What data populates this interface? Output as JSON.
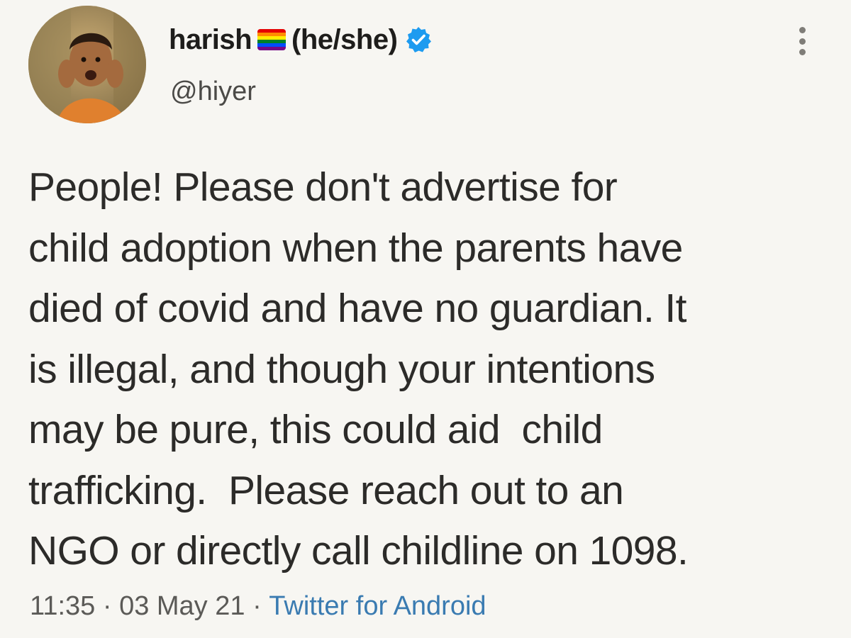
{
  "author": {
    "name": "harish",
    "pronouns": "(he/she)",
    "handle": "@hiyer",
    "flag_icon": "rainbow-flag-icon",
    "verified_icon": "verified-badge-icon",
    "verified_color": "#1d9bf0"
  },
  "tweet": {
    "lines": [
      "People! Please don't advertise for",
      "child adoption when the parents have",
      "died of covid and have no guardian. It",
      "is illegal, and though your intentions",
      "may be pure, this could aid  child",
      "trafficking.  Please reach out to an",
      "NGO or directly call childline on 1098."
    ]
  },
  "meta": {
    "time": "11:35",
    "separator": " · ",
    "date": "03 May 21",
    "source": "Twitter for Android",
    "source_color": "#3a7bb1"
  },
  "menu": {
    "icon": "more-options-icon"
  }
}
